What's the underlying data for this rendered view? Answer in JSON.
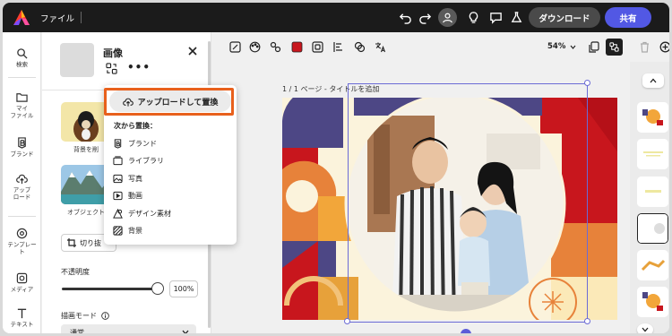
{
  "topbar": {
    "file_menu": "ファイル",
    "download_label": "ダウンロード",
    "share_label": "共有"
  },
  "rail": {
    "items": [
      {
        "label": "検索",
        "icon": "search-icon"
      },
      {
        "label": "マイ\nファイル",
        "icon": "folder-icon"
      },
      {
        "label": "ブランド",
        "icon": "brand-icon"
      },
      {
        "label": "アップ\nロード",
        "icon": "upload-icon"
      },
      {
        "label": "テンプレー\nト",
        "icon": "template-icon"
      },
      {
        "label": "メディア",
        "icon": "media-icon"
      },
      {
        "label": "テキスト",
        "icon": "text-icon"
      }
    ]
  },
  "panel": {
    "title": "画像",
    "option_bg_label": "背景を削",
    "option_obj_label": "オブジェクト",
    "crop_label": "切り抜",
    "opacity_label": "不透明度",
    "opacity_value": "100%",
    "blend_label": "描画モード",
    "blend_value": "通常"
  },
  "popup": {
    "upload_label": "アップロードして置換",
    "heading": "次から置換：",
    "items": [
      {
        "label": "ブランド",
        "icon": "brand-icon"
      },
      {
        "label": "ライブラリ",
        "icon": "library-icon"
      },
      {
        "label": "写真",
        "icon": "photo-icon"
      },
      {
        "label": "動画",
        "icon": "video-icon"
      },
      {
        "label": "デザイン素材",
        "icon": "design-asset-icon"
      },
      {
        "label": "背景",
        "icon": "background-icon"
      }
    ]
  },
  "toolbar2": {
    "zoom": "54%"
  },
  "canvas": {
    "page_label": "1 / 1 ページ - タイトルを追加"
  },
  "colors": {
    "topbar_bg": "#1b1b1b",
    "share_button": "#5258e4",
    "highlight": "#e8601c",
    "selection": "#6b6bd6",
    "canvas_red": "#c8161d",
    "canvas_navy": "#4d4785",
    "canvas_orange": "#e7823a"
  }
}
